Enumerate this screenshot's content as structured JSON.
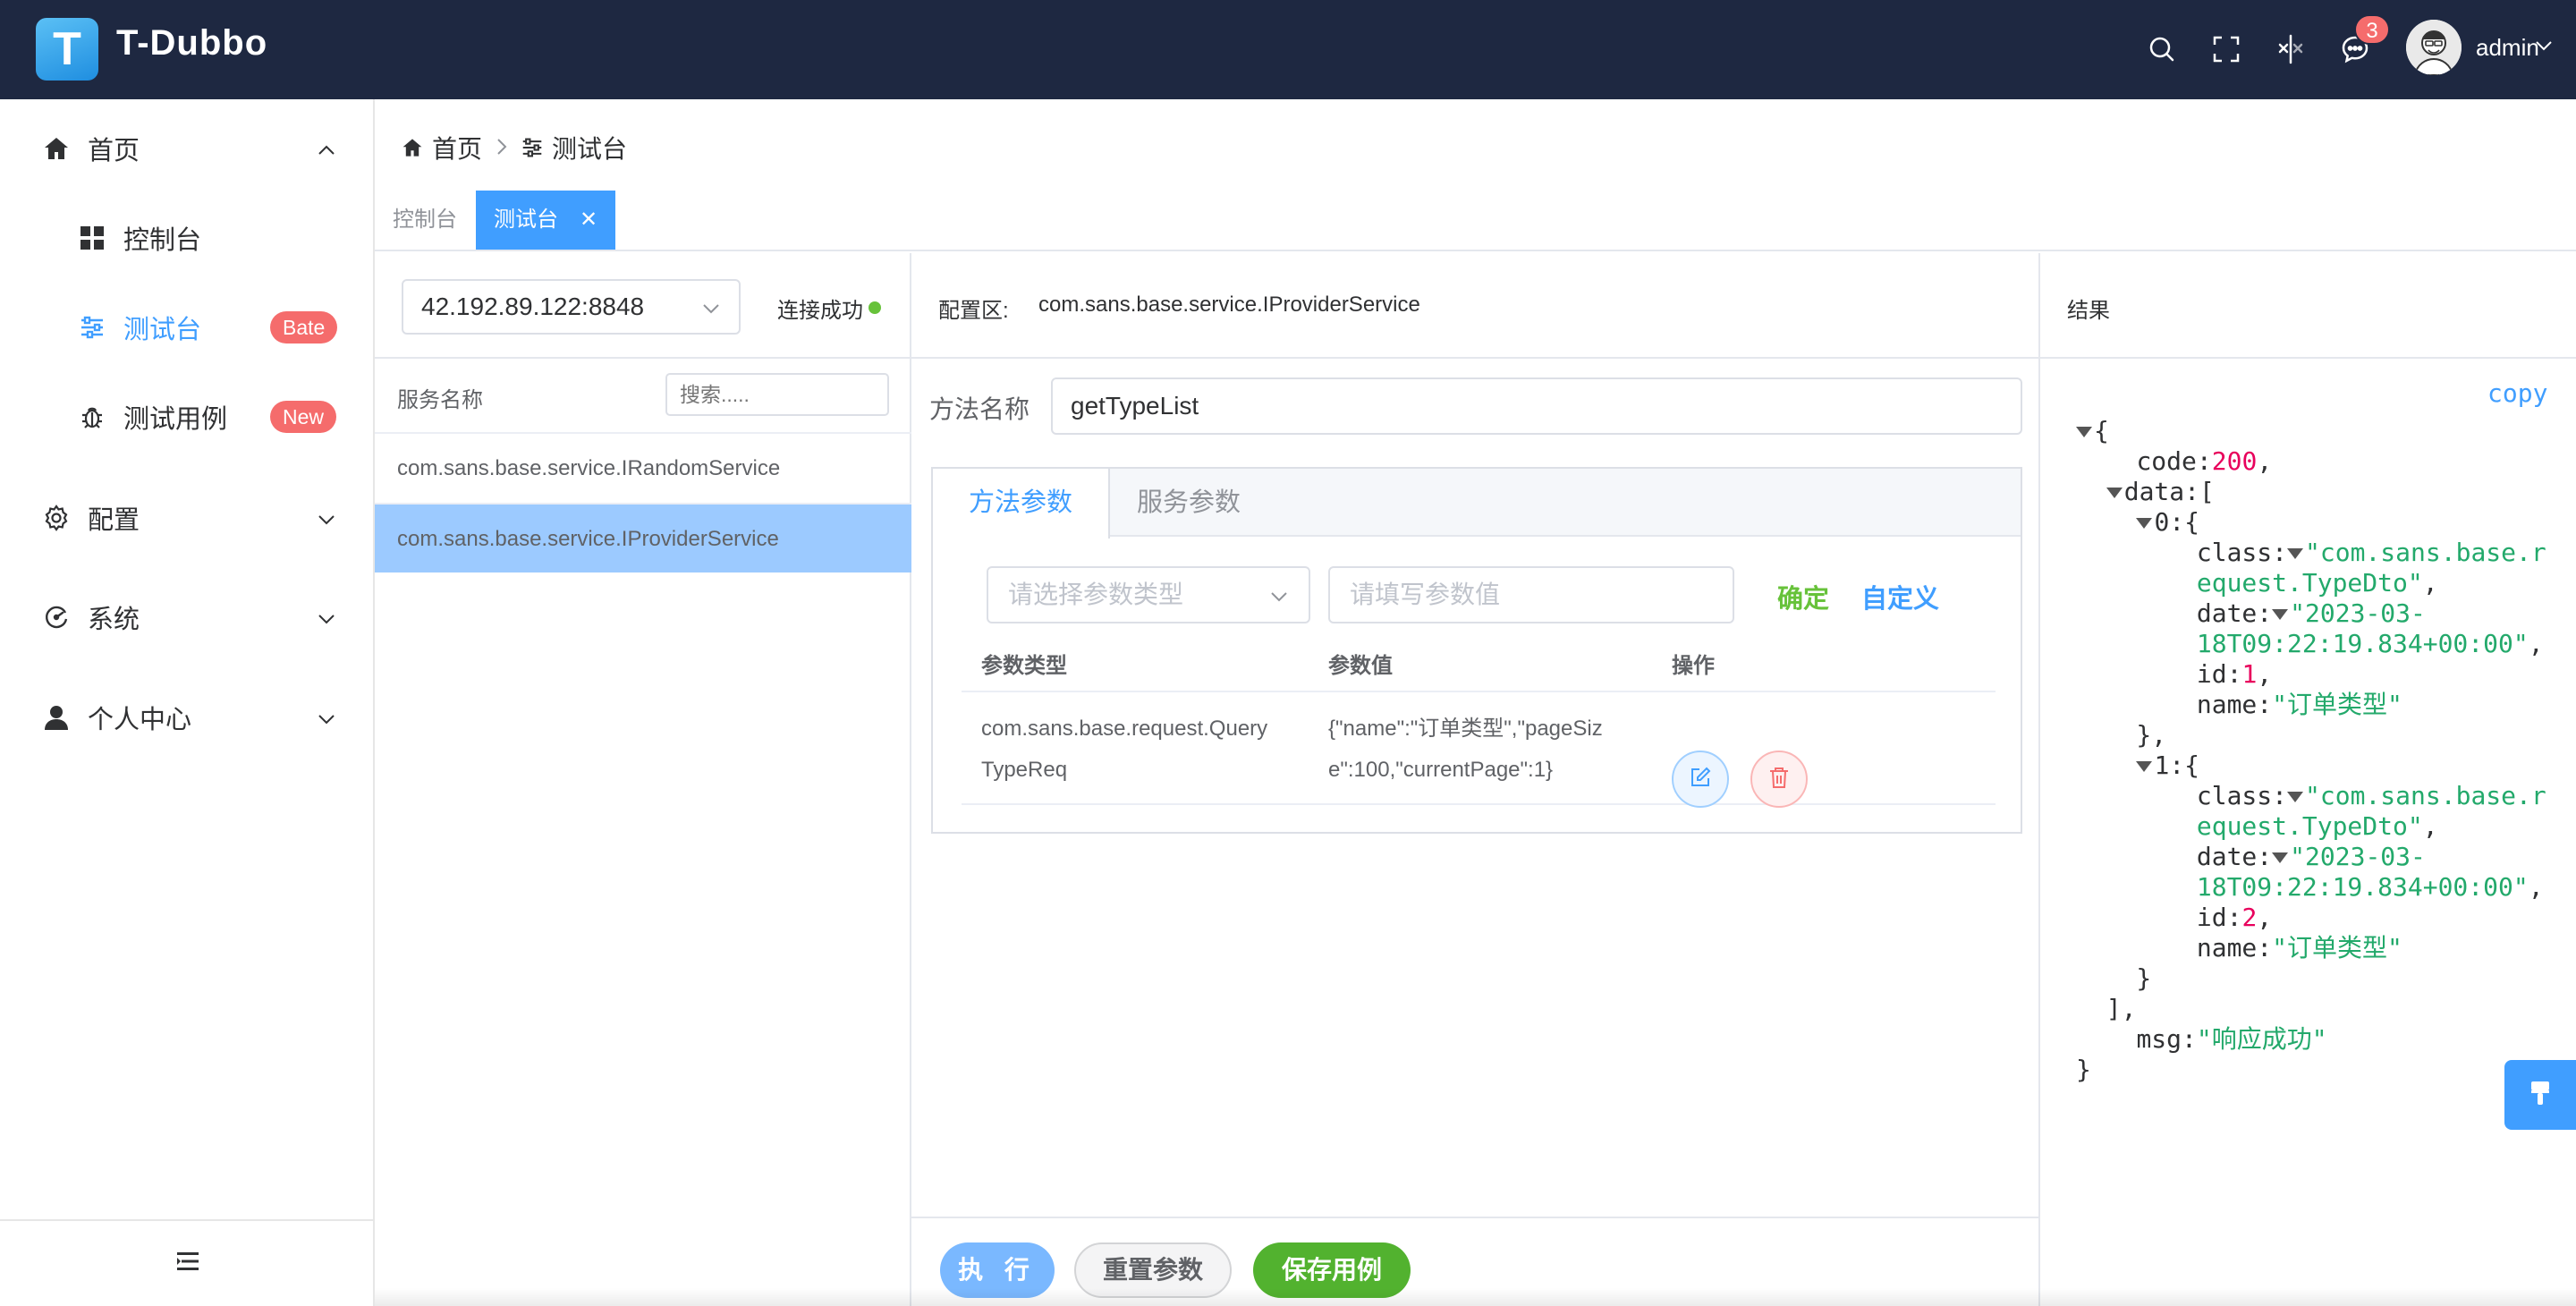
{
  "header": {
    "brand_letter": "T",
    "brand_name": "T-Dubbo",
    "notification_count": "3",
    "username": "admin",
    "bg_color": "#1e2841"
  },
  "sidebar": {
    "items": [
      {
        "label": "首页",
        "icon": "home-icon"
      },
      {
        "label": "控制台",
        "icon": "dashboard-icon"
      },
      {
        "label": "测试台",
        "icon": "sliders-icon",
        "tag": "Bate"
      },
      {
        "label": "测试用例",
        "icon": "bug-icon",
        "tag": "New"
      },
      {
        "label": "配置",
        "icon": "gear-icon"
      },
      {
        "label": "系统",
        "icon": "system-icon"
      },
      {
        "label": "个人中心",
        "icon": "user-icon"
      }
    ]
  },
  "breadcrumb": {
    "home": "首页",
    "current": "测试台"
  },
  "tabs": [
    {
      "label": "控制台"
    },
    {
      "label": "测试台"
    }
  ],
  "registry": {
    "address": "42.192.89.122:8848",
    "status": "连接成功"
  },
  "services": {
    "header": "服务名称",
    "search_placeholder": "搜索.....",
    "items": [
      "com.sans.base.service.IRandomService",
      "com.sans.base.service.IProviderService"
    ],
    "selected_index": 1
  },
  "config": {
    "label": "配置区:",
    "service": "com.sans.base.service.IProviderService",
    "method_label": "方法名称",
    "method_value": "getTypeList",
    "tabs": [
      "方法参数",
      "服务参数"
    ],
    "param_type_placeholder": "请选择参数类型",
    "param_value_placeholder": "请填写参数值",
    "confirm": "确定",
    "custom": "自定义",
    "columns": [
      "参数类型",
      "参数值",
      "操作"
    ],
    "rows": [
      {
        "type_line1": "com.sans.base.request.Query",
        "type_line2": "TypeReq",
        "value_line1": "{\"name\":\"订单类型\",\"pageSiz",
        "value_line2": "e\":100,\"currentPage\":1}"
      }
    ],
    "buttons": {
      "execute": "执 行",
      "reset": "重置参数",
      "save": "保存用例"
    }
  },
  "result": {
    "header": "结果",
    "copy": "copy",
    "json": {
      "code": "200",
      "item0_class_a": "\"com.sans.base.r",
      "item0_class_b": "equest.TypeDto\"",
      "item0_date_a": "\"2023-03-",
      "item0_date_b": "18T09:22:19.834+00:00\"",
      "item0_id": "1",
      "item0_name": "\"订单类型\"",
      "item1_class_a": "\"com.sans.base.r",
      "item1_class_b": "equest.TypeDto\"",
      "item1_date_a": "\"2023-03-",
      "item1_date_b": "18T09:22:19.834+00:00\"",
      "item1_id": "2",
      "item1_name": "\"订单类型\"",
      "msg": "\"响应成功\""
    }
  }
}
